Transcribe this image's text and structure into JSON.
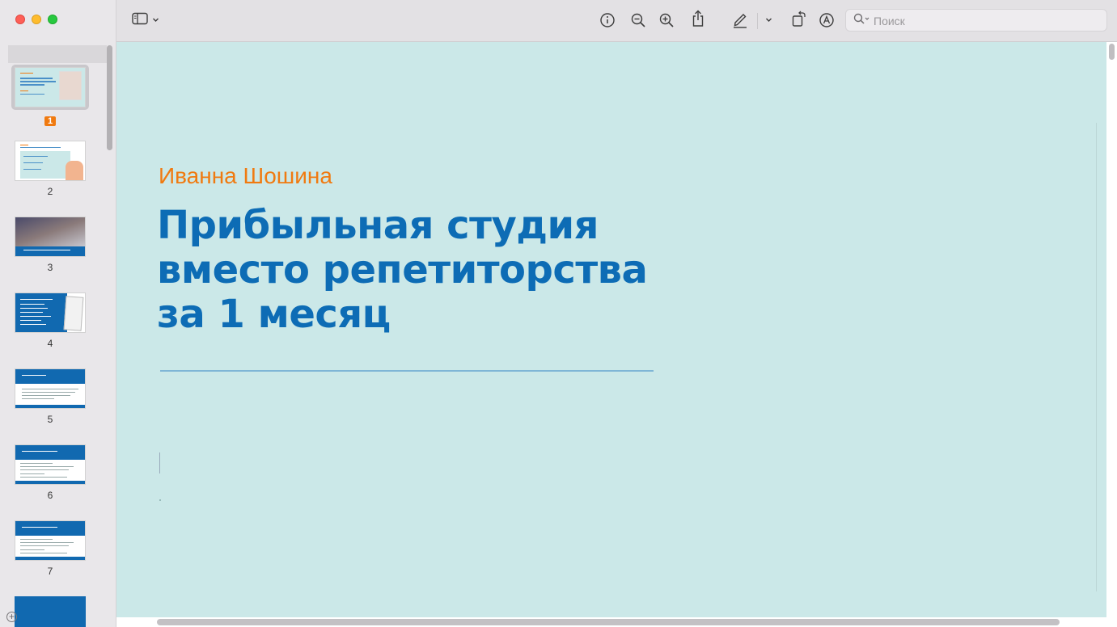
{
  "window": {
    "controls": [
      "close",
      "minimize",
      "maximize"
    ]
  },
  "toolbar": {
    "icons": [
      "sidebar-toggle-icon",
      "chevron-down-icon",
      "info-icon",
      "zoom-out-icon",
      "zoom-in-icon",
      "share-icon",
      "markup-pen-icon",
      "chevron-down-icon",
      "rotate-icon",
      "annotate-icon"
    ],
    "search_placeholder": "Поиск"
  },
  "sidebar": {
    "thumbnails": [
      {
        "page": "1",
        "selected": true
      },
      {
        "page": "2",
        "selected": false
      },
      {
        "page": "3",
        "selected": false
      },
      {
        "page": "4",
        "selected": false
      },
      {
        "page": "5",
        "selected": false
      },
      {
        "page": "6",
        "selected": false
      },
      {
        "page": "7",
        "selected": false
      }
    ]
  },
  "slide": {
    "author": "Иванна Шошина",
    "headline_lines": [
      "Прибыльная студия",
      "вместо репетиторства",
      "за 1 месяц"
    ]
  },
  "colors": {
    "slide_bg": "#cbe8e8",
    "accent_orange": "#f07a10",
    "headline_blue": "#0d6cb5"
  }
}
